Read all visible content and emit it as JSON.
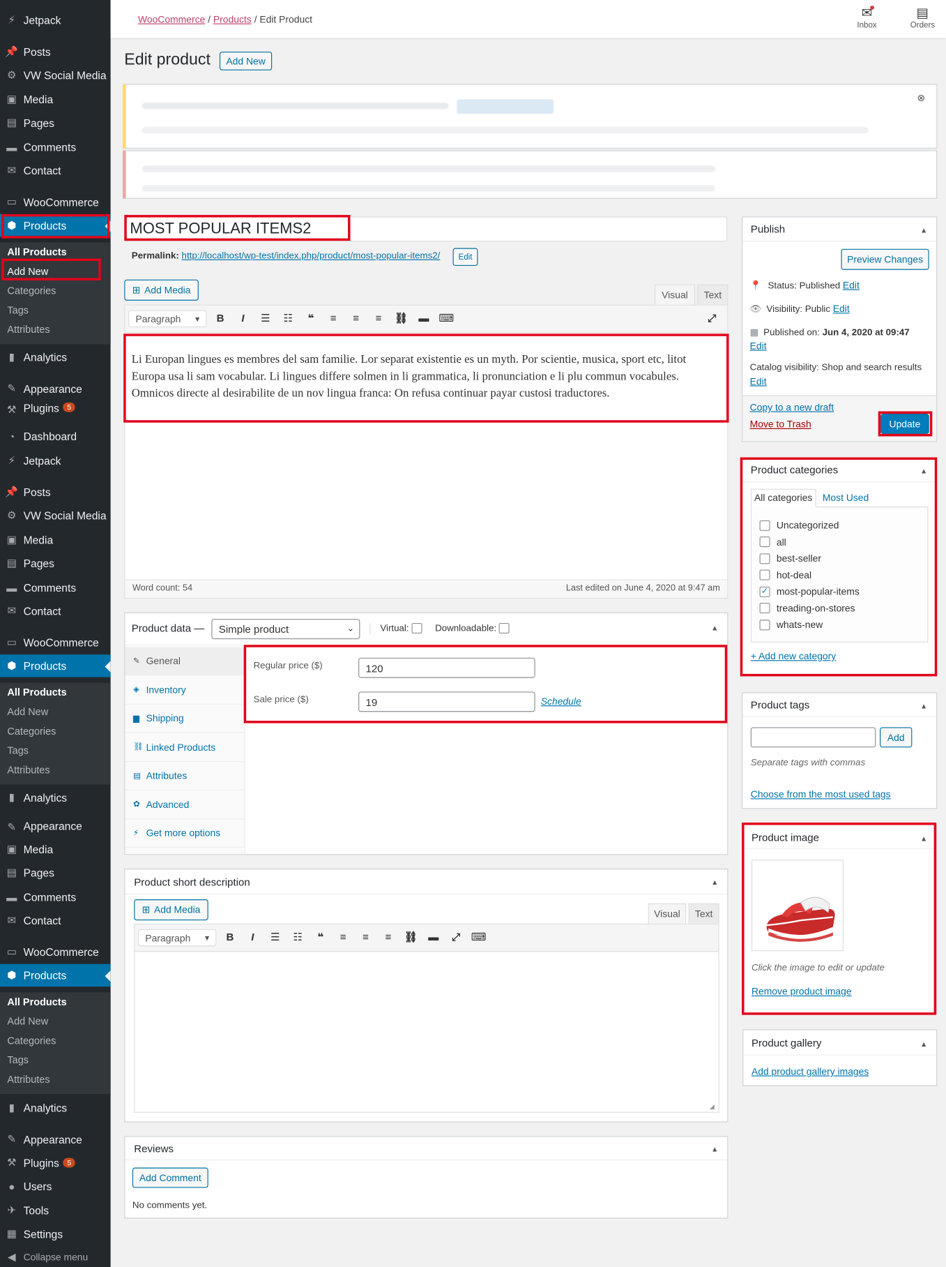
{
  "sidebar": {
    "jetpack": "Jetpack",
    "posts": "Posts",
    "vw_social": "VW Social Media",
    "media": "Media",
    "pages": "Pages",
    "comments": "Comments",
    "contact": "Contact",
    "woocommerce": "WooCommerce",
    "products": "Products",
    "dashboard": "Dashboard",
    "analytics": "Analytics",
    "appearance": "Appearance",
    "plugins": "Plugins",
    "plugins_badge": "5",
    "users": "Users",
    "tools": "Tools",
    "settings": "Settings",
    "collapse": "Collapse menu",
    "sub": {
      "all_products": "All Products",
      "add_new": "Add New",
      "categories": "Categories",
      "tags": "Tags",
      "attributes": "Attributes"
    }
  },
  "topbar": {
    "crumb_woo": "WooCommerce",
    "crumb_products": "Products",
    "crumb_current": "Edit Product",
    "sep": "/",
    "inbox": "Inbox",
    "orders": "Orders"
  },
  "page": {
    "heading": "Edit product",
    "add_new": "Add New"
  },
  "post": {
    "title": "MOST POPULAR ITEMS2",
    "permalink_label": "Permalink:",
    "permalink_url": "http://localhost/wp-test/index.php/product/most-popular-items2/",
    "permalink_edit": "Edit",
    "content": "Li Europan lingues es membres del sam familie. Lor separat existentie es un myth. Por scientie, musica, sport etc, litot Europa usa li sam vocabular. Li lingues differe solmen in li grammatica, li pronunciation e li plu commun vocabules. Omnicos directe al desirabilite de un nov lingua franca: On refusa continuar payar custosi traductores.",
    "word_count": "Word count: 54",
    "last_edited": "Last edited on June 4, 2020 at 9:47 am"
  },
  "editor": {
    "add_media": "Add Media",
    "visual": "Visual",
    "text": "Text",
    "paragraph": "Paragraph"
  },
  "product_data": {
    "label": "Product data —",
    "type": "Simple product",
    "virtual": "Virtual:",
    "downloadable": "Downloadable:",
    "tabs": [
      "General",
      "Inventory",
      "Shipping",
      "Linked Products",
      "Attributes",
      "Advanced",
      "Get more options"
    ],
    "regular_price_label": "Regular price ($)",
    "regular_price": "120",
    "sale_price_label": "Sale price ($)",
    "sale_price": "19",
    "schedule": "Schedule"
  },
  "short_desc": {
    "title": "Product short description"
  },
  "reviews": {
    "title": "Reviews",
    "add_comment": "Add Comment",
    "none": "No comments yet."
  },
  "publish": {
    "title": "Publish",
    "preview": "Preview Changes",
    "status_label": "Status:",
    "status": "Published",
    "edit": "Edit",
    "visibility_label": "Visibility:",
    "visibility": "Public",
    "published_label": "Published on:",
    "published": "Jun 4, 2020 at 09:47",
    "catalog_label": "Catalog visibility:",
    "catalog": "Shop and search results",
    "copy": "Copy to a new draft",
    "trash": "Move to Trash",
    "update": "Update"
  },
  "categories": {
    "title": "Product categories",
    "tab_all": "All categories",
    "tab_used": "Most Used",
    "items": [
      {
        "name": "Uncategorized",
        "checked": false
      },
      {
        "name": "all",
        "checked": false
      },
      {
        "name": "best-seller",
        "checked": false
      },
      {
        "name": "hot-deal",
        "checked": false
      },
      {
        "name": "most-popular-items",
        "checked": true
      },
      {
        "name": "treading-on-stores",
        "checked": false
      },
      {
        "name": "whats-new",
        "checked": false
      }
    ],
    "add": "+ Add new category"
  },
  "tags": {
    "title": "Product tags",
    "add": "Add",
    "hint": "Separate tags with commas",
    "choose": "Choose from the most used tags"
  },
  "image": {
    "title": "Product image",
    "hint": "Click the image to edit or update",
    "remove": "Remove product image"
  },
  "gallery": {
    "title": "Product gallery",
    "add": "Add product gallery images"
  },
  "colors": {
    "accent": "#0073aa",
    "highlight": "#e2051a",
    "sidebar": "#23282d",
    "link": "#0071a1"
  }
}
